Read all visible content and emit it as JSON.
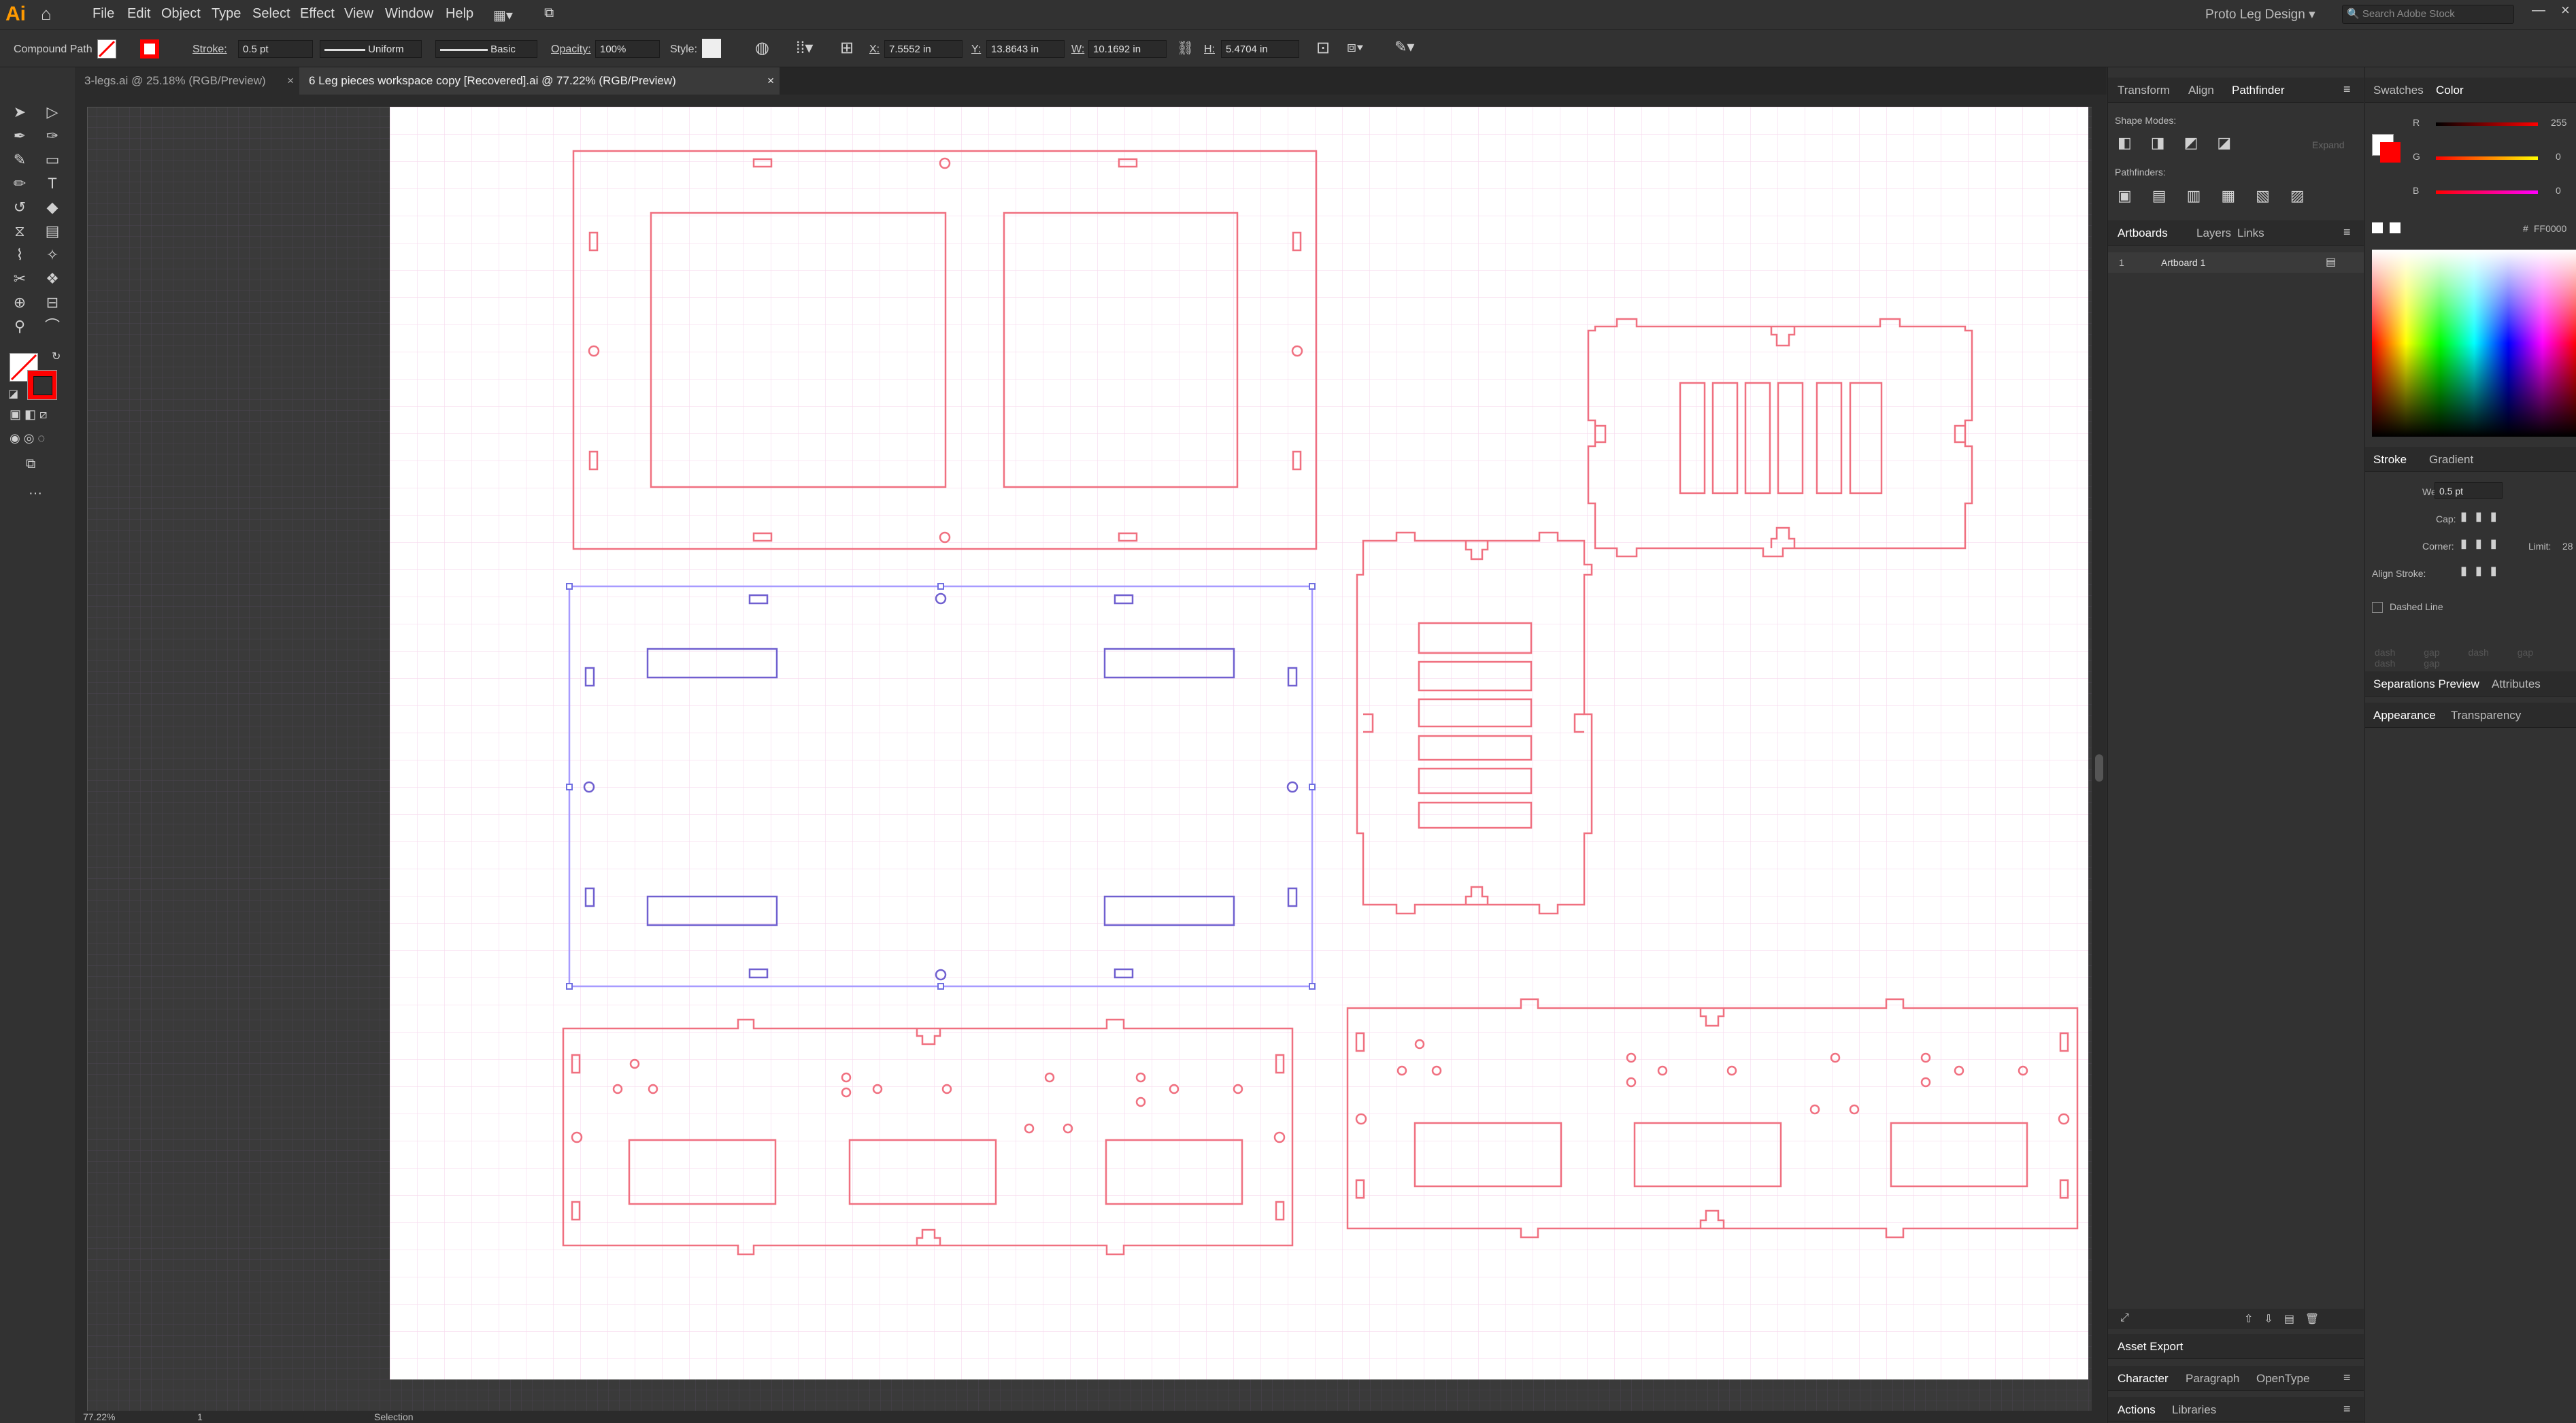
{
  "menubar": {
    "logo": "Ai",
    "items": [
      "File",
      "Edit",
      "Object",
      "Type",
      "Select",
      "Effect",
      "View",
      "Window",
      "Help"
    ],
    "workspace": "Proto Leg Design",
    "search_placeholder": "Search Adobe Stock"
  },
  "control": {
    "selection": "Compound Path",
    "stroke_label": "Stroke:",
    "stroke_value": "0.5 pt",
    "profile": "Uniform",
    "brush": "Basic",
    "opacity_label": "Opacity:",
    "opacity_value": "100%",
    "style_label": "Style:",
    "x_label": "X:",
    "x_value": "7.5552 in",
    "y_label": "Y:",
    "y_value": "13.8643 in",
    "w_label": "W:",
    "w_value": "10.1692 in",
    "h_label": "H:",
    "h_value": "5.4704 in",
    "fill_color": "#ffffff",
    "stroke_color": "#ff0000"
  },
  "tabs": [
    {
      "label": "3-legs.ai @ 25.18% (RGB/Preview)"
    },
    {
      "label": "6 Leg pieces workspace copy [Recovered].ai @ 77.22% (RGB/Preview)"
    }
  ],
  "right_panel": {
    "tabs1": [
      "Transform",
      "Align",
      "Pathfinder"
    ],
    "shape_modes": "Shape Modes:",
    "expand": "Expand",
    "pathfinders": "Pathfinders:",
    "tabs2": [
      "Artboards",
      "Layers",
      "Links"
    ],
    "artboard_num": "1",
    "artboard_name": "Artboard 1"
  },
  "color_panel": {
    "tabs": [
      "Swatches",
      "Color"
    ],
    "r_label": "R",
    "r_value": "255",
    "g_label": "G",
    "g_value": "0",
    "b_label": "B",
    "b_value": "0",
    "hex_label": "#",
    "hex_value": "FF0000"
  },
  "stroke_panel": {
    "tabs": [
      "Stroke",
      "Gradient"
    ],
    "weight_label": "Weight:",
    "weight_value": "0.5 pt",
    "cap_label": "Cap:",
    "corner_label": "Corner:",
    "limit_label": "Limit:",
    "limit_value": "28",
    "align_label": "Align Stroke:",
    "dashed_label": "Dashed Line",
    "dash_labels": [
      "dash",
      "gap",
      "dash",
      "gap",
      "dash",
      "gap"
    ]
  },
  "lower_tabs": {
    "sep": [
      "Separations Preview",
      "Attributes"
    ],
    "app": [
      "Appearance",
      "Transparency"
    ]
  },
  "bottom_panels": {
    "asset_export": "Asset Export",
    "char_tabs": [
      "Character",
      "Paragraph",
      "OpenType"
    ],
    "act_tabs": [
      "Actions",
      "Libraries"
    ]
  },
  "status": {
    "zoom": "77.22%",
    "artboard": "1",
    "tool": "Selection"
  },
  "colors": {
    "stroke_red": "#f07080",
    "selected_blue": "#6f6fe0",
    "grid_pink": "#f7d6ef",
    "ai_orange": "#ff9a00"
  }
}
